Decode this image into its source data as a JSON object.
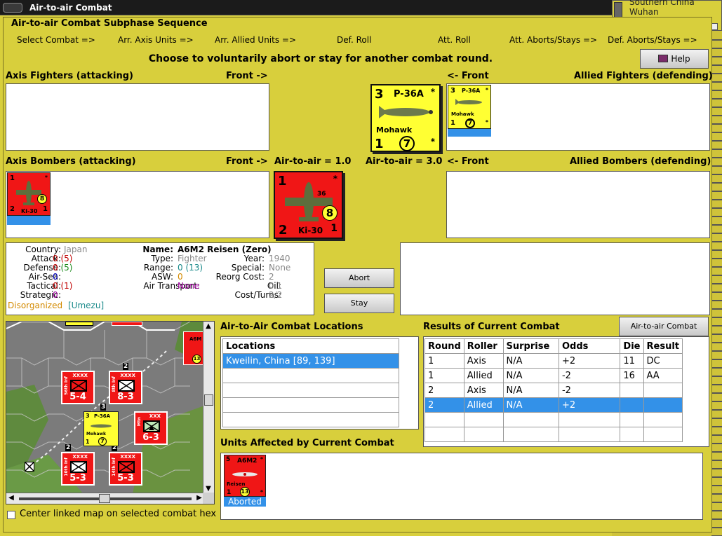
{
  "window": {
    "title": "Air-to-air Combat"
  },
  "minimap": {
    "lines": [
      "Southern China",
      "Wuhan"
    ]
  },
  "subphase": {
    "title": "Air-to-air Combat Subphase Sequence",
    "steps": [
      "Select Combat =>",
      "Arr. Axis Units =>",
      "Arr. Allied Units =>",
      "Def. Roll",
      "Att. Roll",
      "Att. Aborts/Stays =>",
      "Def. Aborts/Stays =>"
    ]
  },
  "prompt": "Choose to voluntarily abort or stay for another combat round.",
  "help_label": "Help",
  "sections": {
    "axis_fighters": "Axis Fighters (attacking)",
    "axis_front": "Front ->",
    "allied_front": "<- Front",
    "allied_fighters": "Allied Fighters (defending)",
    "axis_bombers": "Axis Bombers (attacking)",
    "axis_bombers_front": "Front ->",
    "air_to_air_axis": "Air-to-air = 1.0",
    "air_to_air_allied": "Air-to-air = 3.0",
    "allied_bombers_front": "<- Front",
    "allied_bombers": "Allied Bombers (defending)"
  },
  "big_allied_counter": {
    "left_top": "3",
    "name": "P-36A",
    "corner": "*",
    "label": "Mohawk",
    "left_bottom": "1",
    "circle": "7",
    "corner2": "*"
  },
  "small_allied_counter": {
    "left_top": "3",
    "name": "P-36A",
    "corner": "*",
    "label": "Mohawk",
    "left_bottom": "1",
    "circle": "7",
    "corner2": "*"
  },
  "big_axis_counter": {
    "left_top": "1",
    "corner": "*",
    "tail": "36",
    "circle": "8",
    "left_bottom": "2",
    "label": "Ki-30",
    "right_bottom": "1"
  },
  "small_axis_counter": {
    "left_top": "1",
    "corner": "*",
    "circle": "8",
    "left_bottom": "2",
    "label": "Ki-30",
    "right_bottom": "1"
  },
  "unit_info": {
    "country_k": "Country:",
    "country_v": "Japan",
    "attack_k": "Attack:",
    "attack_v1": "0",
    "attack_v2": "(5)",
    "defense_k": "Defense:",
    "defense_v1": "0",
    "defense_v2": "(5)",
    "airsea_k": "Air-Sea:",
    "airsea_v": "0",
    "tactical_k": "Tactical:",
    "tactical_v1": "0",
    "tactical_v2": "(1)",
    "strategic_k": "Strategic:",
    "strategic_v": "0",
    "disorg": "Disorganized",
    "leader": "[Umezu]",
    "name_k": "Name:",
    "name_v": "A6M2 Reisen (Zero)",
    "type_k": "Type:",
    "type_v": "Fighter",
    "range_k": "Range:",
    "range_v1": "0",
    "range_v2": "(13)",
    "asw_k": "ASW:",
    "asw_v": "0",
    "airtrans_k": "Air Transport:",
    "airtrans_v": "None",
    "year_k": "Year:",
    "year_v": "1940",
    "special_k": "Special:",
    "special_v": "None",
    "reorg_k": "Reorg Cost:",
    "reorg_v": "2",
    "oil_k": "Oil:",
    "oil_v": "0.1",
    "cost_k": "Cost/Turns:",
    "cost_v": "2/2"
  },
  "abort_label": "Abort",
  "stay_label": "Stay",
  "map": {
    "counters": [
      {
        "str": "5-4",
        "sz": "XXXX",
        "side": "56th Inf"
      },
      {
        "str": "8-3",
        "sz": "XXXX",
        "side": "8th Inf"
      },
      {
        "str": "6-3",
        "sz": "XXX",
        "side": "Mtn"
      },
      {
        "str": "5-3",
        "sz": "XXXX",
        "side": "10th Inf"
      },
      {
        "str": "5-3",
        "sz": "XXXX",
        "side": "14th Inf"
      }
    ],
    "stack_labels": [
      "2",
      "3",
      "2",
      "2"
    ],
    "mini_p36": {
      "top": "3",
      "name": "P-36A",
      "label": "Mohawk",
      "bottom": "1",
      "circle": "7"
    },
    "edge_circle": "13",
    "edge_label": "A6M",
    "small_r": "R"
  },
  "locations": {
    "title": "Air-to-Air Combat Locations",
    "header": "Locations",
    "rows": [
      "Kweilin, China [89, 139]",
      "",
      "",
      "",
      ""
    ]
  },
  "results": {
    "title": "Results of Current Combat",
    "chart_button": "Air-to-air Combat Chart",
    "headers": [
      "Round",
      "Roller",
      "Surprise",
      "Odds",
      "Die",
      "Result"
    ],
    "rows": [
      [
        "1",
        "Axis",
        "N/A",
        "+2",
        "11",
        "DC"
      ],
      [
        "1",
        "Allied",
        "N/A",
        "-2",
        "16",
        "AA"
      ],
      [
        "2",
        "Axis",
        "N/A",
        "-2",
        "",
        ""
      ],
      [
        "2",
        "Allied",
        "N/A",
        "+2",
        "",
        ""
      ],
      [
        "",
        "",
        "",
        "",
        "",
        ""
      ],
      [
        "",
        "",
        "",
        "",
        "",
        ""
      ]
    ]
  },
  "affected": {
    "title": "Units Affected by Current Combat",
    "unit": {
      "top": "5",
      "name": "A6M2",
      "corner": "*",
      "label": "Reisen",
      "bottom": "1",
      "circle": "13",
      "corner2": "*"
    },
    "status": "Aborted"
  },
  "center_checkbox_label": "Center linked map on selected combat hex"
}
